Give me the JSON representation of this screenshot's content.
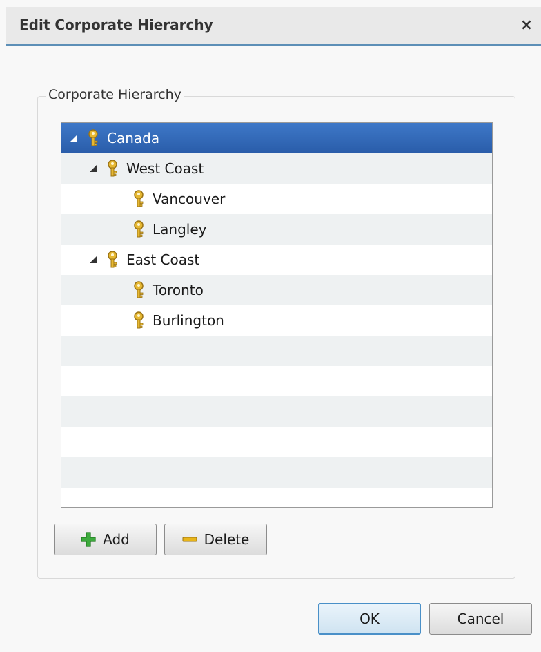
{
  "dialog": {
    "title": "Edit Corporate Hierarchy",
    "close_glyph": "×"
  },
  "group": {
    "legend": "Corporate Hierarchy"
  },
  "tree": {
    "nodes": [
      {
        "label": "Canada",
        "level": 0,
        "expanded": true,
        "selected": true,
        "icon": "key-icon"
      },
      {
        "label": "West Coast",
        "level": 1,
        "expanded": true,
        "selected": false,
        "icon": "key-icon"
      },
      {
        "label": "Vancouver",
        "level": 2,
        "expanded": false,
        "selected": false,
        "icon": "key-icon"
      },
      {
        "label": "Langley",
        "level": 2,
        "expanded": false,
        "selected": false,
        "icon": "key-icon"
      },
      {
        "label": "East Coast",
        "level": 1,
        "expanded": true,
        "selected": false,
        "icon": "key-icon"
      },
      {
        "label": "Toronto",
        "level": 2,
        "expanded": false,
        "selected": false,
        "icon": "key-icon"
      },
      {
        "label": "Burlington",
        "level": 2,
        "expanded": false,
        "selected": false,
        "icon": "key-icon"
      }
    ]
  },
  "buttons": {
    "add_label": "Add",
    "delete_label": "Delete",
    "ok_label": "OK",
    "cancel_label": "Cancel"
  },
  "colors": {
    "selection": "#3e78c8",
    "title_accent": "#5d8fb7",
    "key_gold": "#d9a520",
    "add_green": "#3daa3d",
    "delete_gold": "#e8b51a"
  }
}
